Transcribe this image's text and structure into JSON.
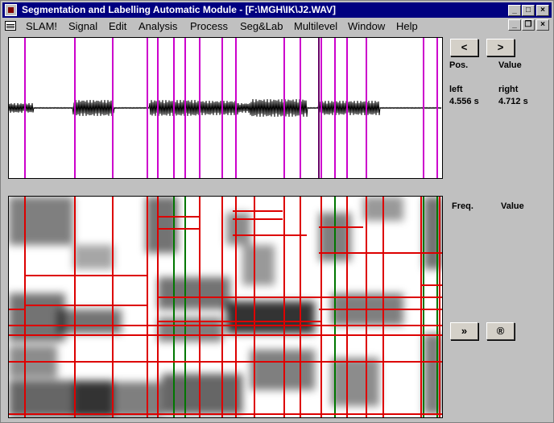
{
  "window": {
    "title": "Segmentation and Labelling Automatic Module - [F:\\MGH\\IK\\J2.WAV]"
  },
  "title_buttons": {
    "minimize": "_",
    "maximize": "□",
    "close": "×"
  },
  "menu": {
    "items": [
      "SLAM!",
      "Signal",
      "Edit",
      "Analysis",
      "Process",
      "Seg&Lab",
      "Multilevel",
      "Window",
      "Help"
    ],
    "child_buttons": {
      "minimize": "_",
      "restore": "❐",
      "close": "×"
    }
  },
  "nav": {
    "prev": "<",
    "next": ">"
  },
  "wave_info": {
    "pos_label": "Pos.",
    "value_label": "Value",
    "left_label": "left",
    "right_label": "right",
    "left_value": "4.556 s",
    "right_value": "4.712 s"
  },
  "spec_info": {
    "freq_label": "Freq.",
    "value_label": "Value"
  },
  "spec_buttons": {
    "forward": "»",
    "registered": "®"
  },
  "colors": {
    "title_bar": "#000080",
    "segment_mark": "#cc00cc",
    "spec_box": "#dd0000",
    "spec_line": "#007700"
  }
}
